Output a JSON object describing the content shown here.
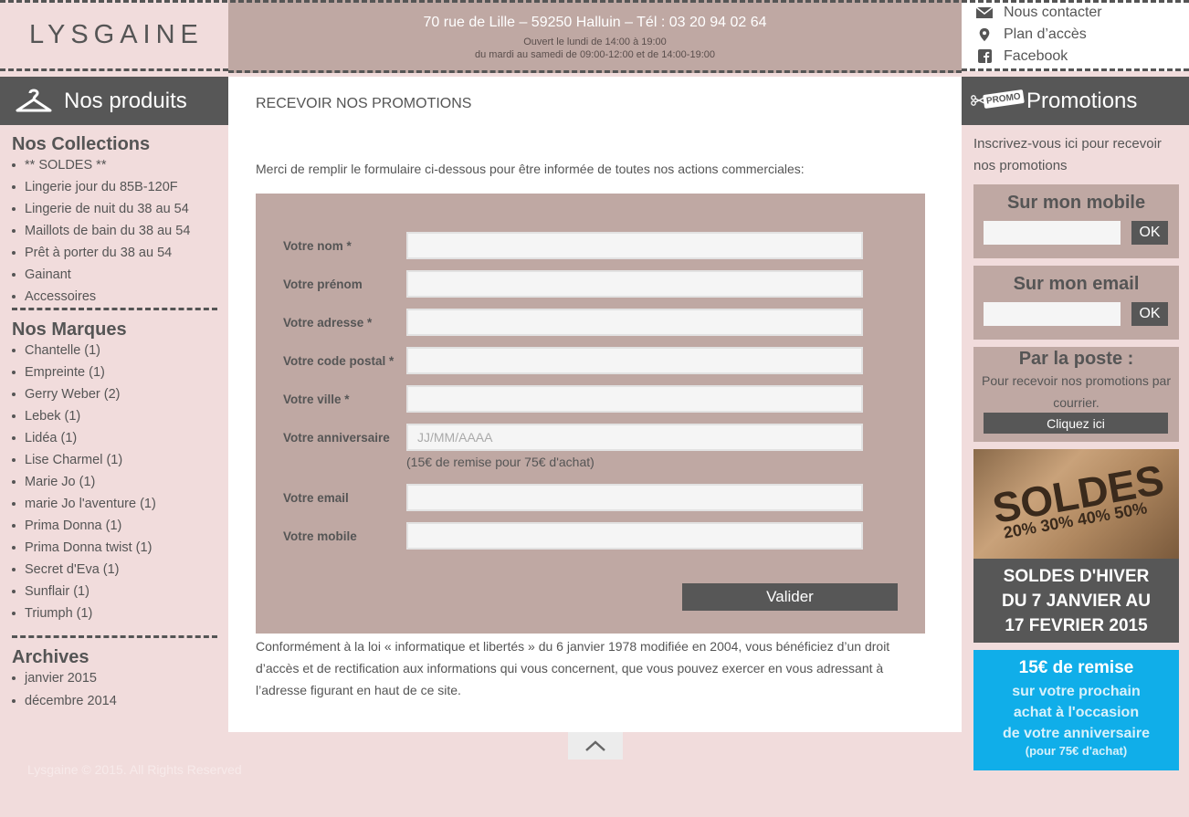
{
  "header": {
    "logo": "LYSGAINE",
    "address": "70 rue de Lille – 59250 Halluin – Tél : 03 20 94 02 64",
    "hours_line1": "Ouvert le lundi de 14:00 à 19:00",
    "hours_line2": "du mardi au samedi de 09:00-12:00 et de 14:00-19:00",
    "links": [
      {
        "label": "Nous contacter",
        "icon": "envelope-icon"
      },
      {
        "label": "Plan d’accès",
        "icon": "map-pin-icon"
      },
      {
        "label": "Facebook",
        "icon": "facebook-icon"
      }
    ]
  },
  "left": {
    "bar_title": "Nos produits",
    "collections_title": "Nos Collections",
    "collections": [
      "** SOLDES **",
      "Lingerie jour du 85B-120F",
      "Lingerie de nuit du 38 au 54",
      "Maillots de bain du 38 au 54",
      "Prêt à porter du 38 au 54",
      "Gainant",
      "Accessoires"
    ],
    "brands_title": "Nos Marques",
    "brands": [
      "Chantelle (1)",
      "Empreinte (1)",
      "Gerry Weber (2)",
      "Lebek (1)",
      "Lidéa (1)",
      "Lise Charmel (1)",
      "Marie Jo (1)",
      "marie Jo l'aventure (1)",
      "Prima Donna (1)",
      "Prima Donna twist (1)",
      "Secret d'Eva (1)",
      "Sunflair (1)",
      "Triumph (1)"
    ],
    "archives_title": "Archives",
    "archives": [
      "janvier 2015",
      "décembre 2014"
    ]
  },
  "main": {
    "title": "RECEVOIR NOS PROMOTIONS",
    "intro": "Merci de remplir le formulaire ci-dessous pour être informée de toutes nos actions commerciales:",
    "fields": [
      {
        "label": "Votre nom *",
        "value": "",
        "placeholder": ""
      },
      {
        "label": "Votre prénom",
        "value": "",
        "placeholder": ""
      },
      {
        "label": "Votre adresse *",
        "value": "",
        "placeholder": ""
      },
      {
        "label": "Votre code postal *",
        "value": "",
        "placeholder": ""
      },
      {
        "label": "Votre ville *",
        "value": "",
        "placeholder": ""
      },
      {
        "label": "Votre anniversaire",
        "value": "",
        "placeholder": "JJ/MM/AAAA"
      },
      {
        "label": "Votre email",
        "value": "",
        "placeholder": ""
      },
      {
        "label": "Votre mobile",
        "value": "",
        "placeholder": ""
      }
    ],
    "birthday_hint": "(15€ de remise pour 75€ d'achat)",
    "submit": "Valider",
    "legal": "Conformément à la loi « informatique et libertés » du 6 janvier 1978 modifiée en 2004, vous bénéficiez d’un droit d’accès et de rectification aux informations qui vous concernent, que vous pouvez exercer en vous adressant à l’adresse figurant en haut de ce site."
  },
  "right": {
    "tag": "PROMO",
    "bar_title": "Promotions",
    "intro": "Inscrivez-vous ici pour recevoir nos promotions",
    "mobile_title": "Sur mon mobile",
    "email_title": "Sur mon email",
    "ok": "OK",
    "poste_title": "Par la poste :",
    "poste_text": "Pour recevoir nos promotions par courrier.",
    "poste_button": "Cliquez ici",
    "soldes_img_word": "SOLDES",
    "soldes_img_pct": "20% 30% 40% 50%",
    "soldes_line1": "SOLDES D'HIVER",
    "soldes_line2": "DU 7 JANVIER AU",
    "soldes_line3": "17 FEVRIER 2015",
    "remise_line1": "15€ de remise",
    "remise_line2": "sur votre prochain",
    "remise_line3": "achat à l'occasion",
    "remise_line4": "de votre anniversaire",
    "remise_line5": "(pour 75€ d'achat)"
  },
  "footer": {
    "copyright": "Lysgaine © 2015. All Rights Reserved"
  }
}
